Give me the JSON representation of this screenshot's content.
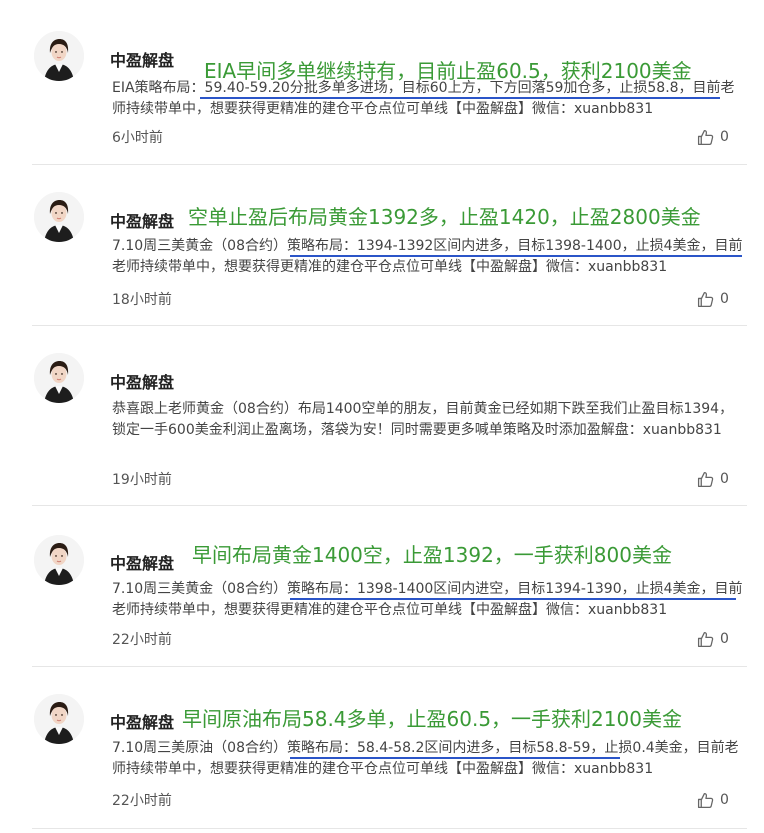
{
  "posts": [
    {
      "author": "中盈解盘",
      "headline": "EIA早间多单继续持有，目前止盈60.5，获利2100美金",
      "body": "EIA策略布局：59.40-59.20分批多单多进场，目标60上方，下方回落59加仓多，止损58.8，目前老师持续带单中，想要获得更精准的建仓平仓点位可单线【中盈解盘】微信：xuanbb831",
      "time": "6小时前",
      "likes": "0"
    },
    {
      "author": "中盈解盘",
      "headline": "空单止盈后布局黄金1392多，止盈1420，止盈2800美金",
      "body": "7.10周三美黄金（08合约）策略布局：1394-1392区间内进多，目标1398-1400，止损4美金，目前老师持续带单中，想要获得更精准的建仓平仓点位可单线【中盈解盘】微信：xuanbb831",
      "time": "18小时前",
      "likes": "0"
    },
    {
      "author": "中盈解盘",
      "headline": "",
      "body": "恭喜跟上老师黄金（08合约）布局1400空单的朋友，目前黄金已经如期下跌至我们止盈目标1394，锁定一手600美金利润止盈离场，落袋为安！同时需要更多喊单策略及时添加盈解盘：xuanbb831",
      "time": "19小时前",
      "likes": "0"
    },
    {
      "author": "中盈解盘",
      "headline": "早间布局黄金1400空，止盈1392，一手获利800美金",
      "body": "7.10周三美黄金（08合约）策略布局：1398-1400区间内进空，目标1394-1390，止损4美金，目前老师持续带单中，想要获得更精准的建仓平仓点位可单线【中盈解盘】微信：xuanbb831",
      "time": "22小时前",
      "likes": "0"
    },
    {
      "author": "中盈解盘",
      "headline": "早间原油布局58.4多单，止盈60.5，一手获利2100美金",
      "body": "7.10周三美原油（08合约）策略布局：58.4-58.2区间内进多，目标58.8-59，止损0.4美金，目前老师持续带单中，想要获得更精准的建仓平仓点位可单线【中盈解盘】微信：xuanbb831",
      "time": "22小时前",
      "likes": "0"
    }
  ],
  "colors": {
    "headline": "#3a9a36",
    "underline": "#2b55c8",
    "divider": "#e6e6e6"
  },
  "icons": {
    "avatar": "profile-photo-icon",
    "like": "thumbs-up-icon"
  }
}
